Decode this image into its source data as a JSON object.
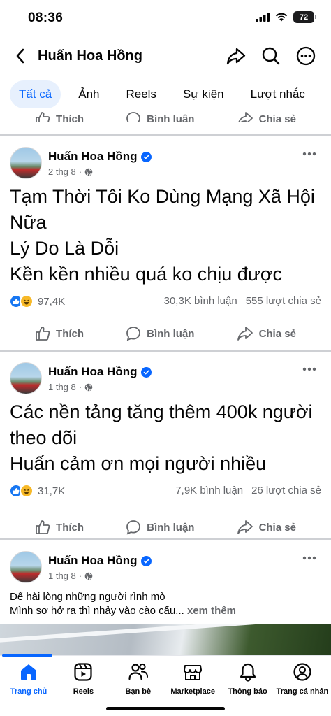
{
  "status_bar": {
    "time": "08:36",
    "battery": "72"
  },
  "header": {
    "title": "Huấn Hoa Hồng"
  },
  "filters": [
    "Tất cả",
    "Ảnh",
    "Reels",
    "Sự kiện",
    "Lượt nhắc"
  ],
  "action_labels": {
    "like": "Thích",
    "comment": "Bình luận",
    "share": "Chia sẻ"
  },
  "posts": [
    {
      "author": "Huấn Hoa Hồng",
      "date": "2 thg 8",
      "lines": [
        "Tạm Thời Tôi Ko Dùng Mạng Xã Hội Nữa",
        "Lý Do Là Dỗi",
        "Kền kền nhiều quá ko chịu được"
      ],
      "reactions": "97,4K",
      "comments": "30,3K bình luận",
      "shares": "555 lượt chia sẻ"
    },
    {
      "author": "Huấn Hoa Hồng",
      "date": "1 thg 8",
      "lines": [
        "Các nền tảng tăng thêm 400k người theo dõi",
        "Huấn cảm ơn mọi người nhiều"
      ],
      "reactions": "31,7K",
      "comments": "7,9K bình luận",
      "shares": "26 lượt chia sẻ"
    },
    {
      "author": "Huấn Hoa Hồng",
      "date": "1 thg 8",
      "lines": [
        "Để hài lòng những người rình mò",
        "Mình sơ hở ra thì nhảy vào cào cấu..."
      ],
      "see_more": "xem thêm"
    }
  ],
  "tabs": [
    "Trang chủ",
    "Reels",
    "Bạn bè",
    "Marketplace",
    "Thông báo",
    "Trang cá nhân"
  ],
  "colors": {
    "accent": "#0866ff",
    "secondary_text": "#65676b",
    "divider": "#ced0d4"
  }
}
